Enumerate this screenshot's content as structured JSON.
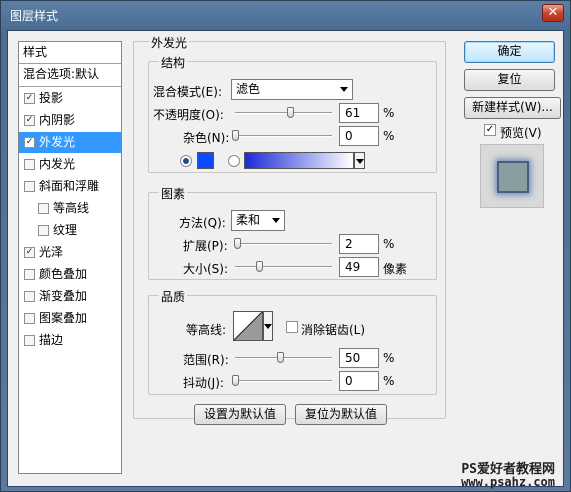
{
  "window": {
    "title": "图层样式",
    "close_glyph": "✕"
  },
  "left_panel": {
    "header": "样式",
    "blend_defaults": "混合选项:默认",
    "items": [
      {
        "label": "投影",
        "checked": true
      },
      {
        "label": "内阴影",
        "checked": true
      },
      {
        "label": "外发光",
        "checked": true,
        "selected": true
      },
      {
        "label": "内发光",
        "checked": false
      },
      {
        "label": "斜面和浮雕",
        "checked": false
      },
      {
        "label": "等高线",
        "checked": false,
        "sub": true
      },
      {
        "label": "纹理",
        "checked": false,
        "sub": true
      },
      {
        "label": "光泽",
        "checked": true
      },
      {
        "label": "颜色叠加",
        "checked": false
      },
      {
        "label": "渐变叠加",
        "checked": false
      },
      {
        "label": "图案叠加",
        "checked": false
      },
      {
        "label": "描边",
        "checked": false
      }
    ]
  },
  "panel_title": "外发光",
  "structure": {
    "title": "结构",
    "blend_mode_label": "混合模式(E):",
    "blend_mode_value": "滤色",
    "opacity_label": "不透明度(O):",
    "opacity_value": "61",
    "opacity_unit": "%",
    "opacity_level": 0.61,
    "noise_label": "杂色(N):",
    "noise_value": "0",
    "noise_unit": "%",
    "noise_level": 0,
    "color_swatch": "#0a4dff",
    "gradient_from": "#1b2bd8",
    "gradient_to": "#ffffff"
  },
  "elements": {
    "title": "图素",
    "method_label": "方法(Q):",
    "method_value": "柔和",
    "spread_label": "扩展(P):",
    "spread_value": "2",
    "spread_unit": "%",
    "spread_level": 0.02,
    "size_label": "大小(S):",
    "size_value": "49",
    "size_unit": "像素"
  },
  "quality": {
    "title": "品质",
    "contour_label": "等高线:",
    "antialias_label": "消除锯齿(L)",
    "antialias_checked": false,
    "range_label": "范围(R):",
    "range_value": "50",
    "range_unit": "%",
    "range_level": 0.5,
    "jitter_label": "抖动(J):",
    "jitter_value": "0",
    "jitter_unit": "%",
    "jitter_level": 0
  },
  "bottom_buttons": {
    "set_default": "设置为默认值",
    "reset_default": "复位为默认值"
  },
  "right_buttons": {
    "ok": "确定",
    "reset": "复位",
    "new_style": "新建样式(W)...",
    "preview_label": "预览(V)",
    "preview_checked": true
  },
  "watermark": {
    "line1": "PS爱好者教程网",
    "line2": "www.psahz.com"
  }
}
